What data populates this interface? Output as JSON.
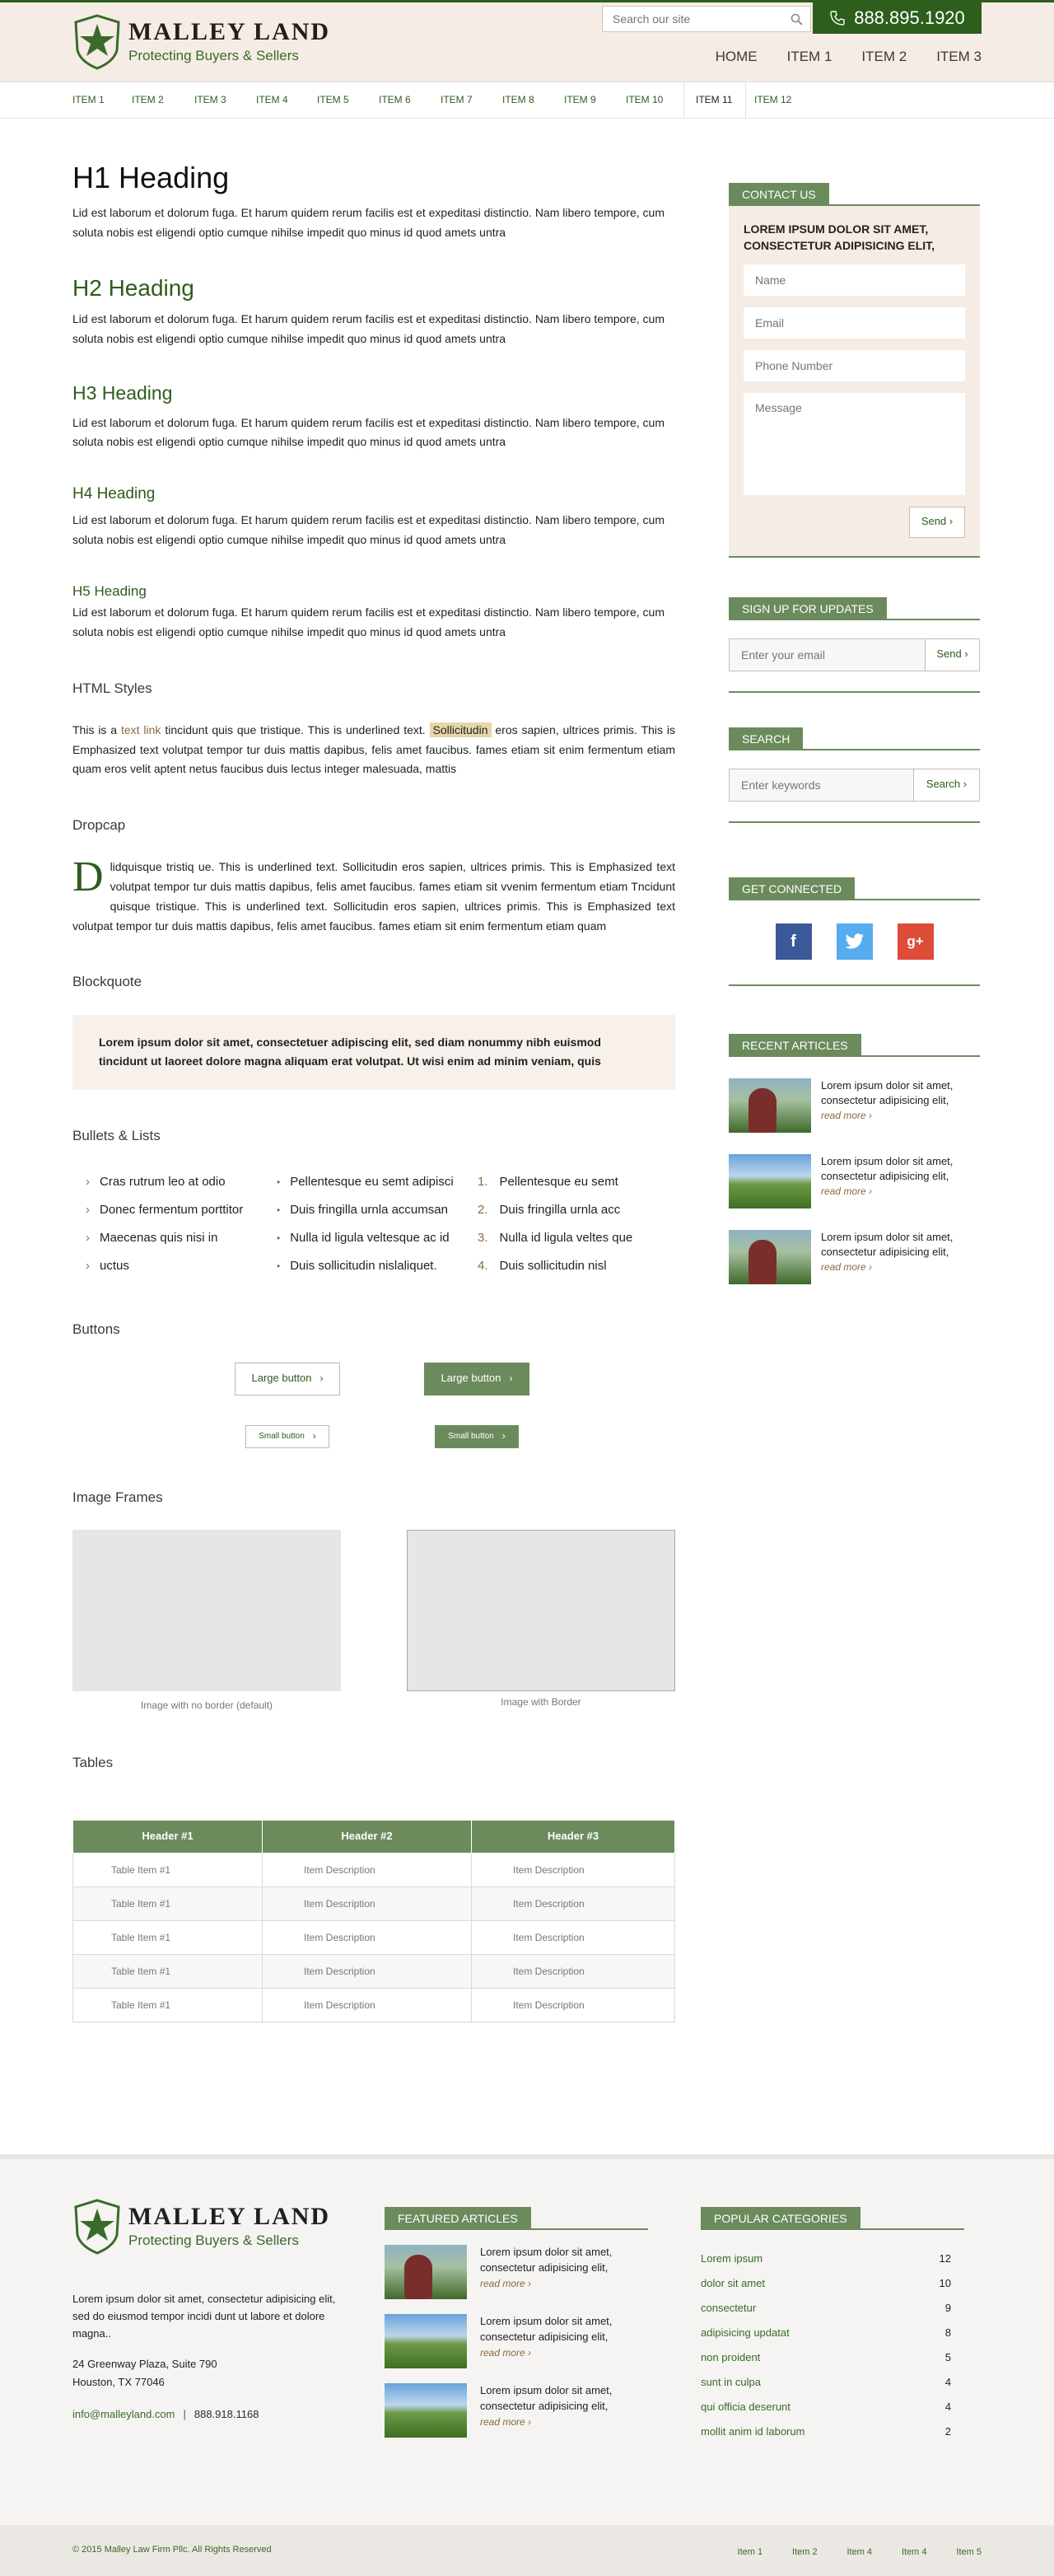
{
  "brand": {
    "name": "MALLEY LAND",
    "tagline": "Protecting Buyers & Sellers",
    "green": "#2d5e1c",
    "accent": "#6b8b5c"
  },
  "header": {
    "search_placeholder": "Search our site",
    "phone": "888.895.1920",
    "main_nav": [
      "HOME",
      "ITEM 1",
      "ITEM 2",
      "ITEM 3"
    ],
    "sub_nav": [
      "ITEM 1",
      "ITEM 2",
      "ITEM 3",
      "ITEM 4",
      "ITEM 5",
      "ITEM 6",
      "ITEM 7",
      "ITEM 8",
      "ITEM 9",
      "ITEM 10",
      "ITEM 11",
      "ITEM 12"
    ],
    "sub_nav_active": "ITEM 11"
  },
  "content": {
    "h1": "H1 Heading",
    "h2": "H2 Heading",
    "h3": "H3 Heading",
    "h4": "H4 Heading",
    "h5": "H5 Heading",
    "para": "Lid est laborum et dolorum fuga. Et harum quidem rerum facilis est et expeditasi distinctio. Nam libero tempore, cum soluta nobis est eligendi optio cumque nihilse impedit quo minus id quod amets untra",
    "html_styles_title": "HTML Styles",
    "html_styles": {
      "a": "This is a ",
      "link": "text link",
      "b": " tincidunt quis que tristique. This is underlined text. ",
      "highlight": "Sollicitudin",
      "c": " eros sapien, ultrices primis. This is Emphasized text volutpat tempor tur duis mattis dapibus, felis amet faucibus. fames etiam sit enim fermentum etiam quam eros velit aptent netus faucibus duis lectus integer malesuada, mattis"
    },
    "dropcap_title": "Dropcap",
    "dropcap_letter": "D",
    "dropcap_text": "lidquisque tristiq ue. This is underlined text.   Sollicitudin eros sapien, ultrices primis. This is Emphasized text  volutpat tempor tur duis mattis dapibus, felis amet faucibus. fames etiam sit vvenim fermentum etiam Tncidunt quisque tristique. This is underlined text.   Sollicitudin eros sapien, ultrices primis. This is Emphasized text  volutpat tempor tur duis mattis dapibus, felis amet faucibus. fames etiam sit enim fermentum etiam quam",
    "blockquote_title": "Blockquote",
    "blockquote": "Lorem ipsum dolor sit amet, consectetuer adipiscing elit, sed diam nonummy nibh euismod tincidunt ut laoreet dolore magna aliquam erat volutpat. Ut wisi enim ad minim veniam, quis",
    "lists_title": "Bullets & Lists",
    "list1": [
      "Cras rutrum leo at odio",
      "Donec fermentum porttitor",
      "Maecenas quis nisi in",
      "uctus"
    ],
    "list2": [
      "Pellentesque eu semt adipisci",
      "Duis fringilla urnla accumsan",
      "Nulla id ligula veltesque ac id",
      "Duis sollicitudin  nislaliquet."
    ],
    "list3": [
      {
        "n": "1.",
        "t": "Pellentesque eu semt"
      },
      {
        "n": "2.",
        "t": "Duis fringilla urnla acc"
      },
      {
        "n": "3.",
        "t": "Nulla id ligula veltes que"
      },
      {
        "n": "4.",
        "t": "Duis sollicitudin  nisl"
      }
    ],
    "buttons_title": "Buttons",
    "button_large": "Large button",
    "button_small": "Small button",
    "frames_title": "Image Frames",
    "frame_caption_1": "Image with no border (default)",
    "frame_caption_2": "Image with Border",
    "tables_title": "Tables",
    "table_headers": [
      "Header #1",
      "Header #2",
      "Header #3"
    ],
    "table_rows": [
      [
        "Table Item #1",
        "Item Description",
        "Item Description"
      ],
      [
        "Table Item #1",
        "Item Description",
        "Item Description"
      ],
      [
        "Table Item #1",
        "Item Description",
        "Item Description"
      ],
      [
        "Table Item #1",
        "Item Description",
        "Item Description"
      ],
      [
        "Table Item #1",
        "Item Description",
        "Item Description"
      ]
    ]
  },
  "sidebar": {
    "contact_title": "CONTACT US",
    "contact_lead": "LOREM IPSUM DOLOR SIT AMET, CONSECTETUR ADIPISICING ELIT,",
    "name_ph": "Name",
    "email_ph": "Email",
    "phone_ph": "Phone Number",
    "message_ph": "Message",
    "send": "Send",
    "signup_title": "SIGN UP FOR UPDATES",
    "signup_ph": "Enter your email",
    "search_title": "SEARCH",
    "search_ph": "Enter keywords",
    "search_btn": "Search",
    "connected_title": "GET CONNECTED",
    "social": [
      "facebook-icon",
      "twitter-icon",
      "google-plus-icon"
    ],
    "recent_title": "RECENT ARTICLES",
    "article_text": "Lorem ipsum dolor sit amet, consectetur adipisicing elit,",
    "read_more": "read more"
  },
  "footer": {
    "about": "Lorem ipsum dolor sit amet, consectetur adipisicing elit, sed do eiusmod tempor incidi dunt ut labore et dolore magna..",
    "address1": "24 Greenway Plaza, Suite 790",
    "address2": "Houston, TX 77046",
    "email": "info@malleyland.com",
    "phone": "888.918.1168",
    "featured_title": "FEATURED ARTICLES",
    "popular_title": "POPULAR CATEGORIES",
    "categories": [
      {
        "name": "Lorem ipsum",
        "count": "12"
      },
      {
        "name": "dolor sit amet",
        "count": "10"
      },
      {
        "name": "consectetur",
        "count": "9"
      },
      {
        "name": "adipisicing updatat",
        "count": "8"
      },
      {
        "name": "non proident",
        "count": "5"
      },
      {
        "name": "sunt in culpa",
        "count": "4"
      },
      {
        "name": "qui officia deserunt",
        "count": "4"
      },
      {
        "name": "mollit anim id laborum",
        "count": "2"
      }
    ],
    "copyright": "© 2015 Malley Law Firm Pllc. All Rights Reserved",
    "bottom_nav": [
      "Item 1",
      "Item 2",
      "Item 4",
      "Item 4",
      "Item 5"
    ]
  }
}
